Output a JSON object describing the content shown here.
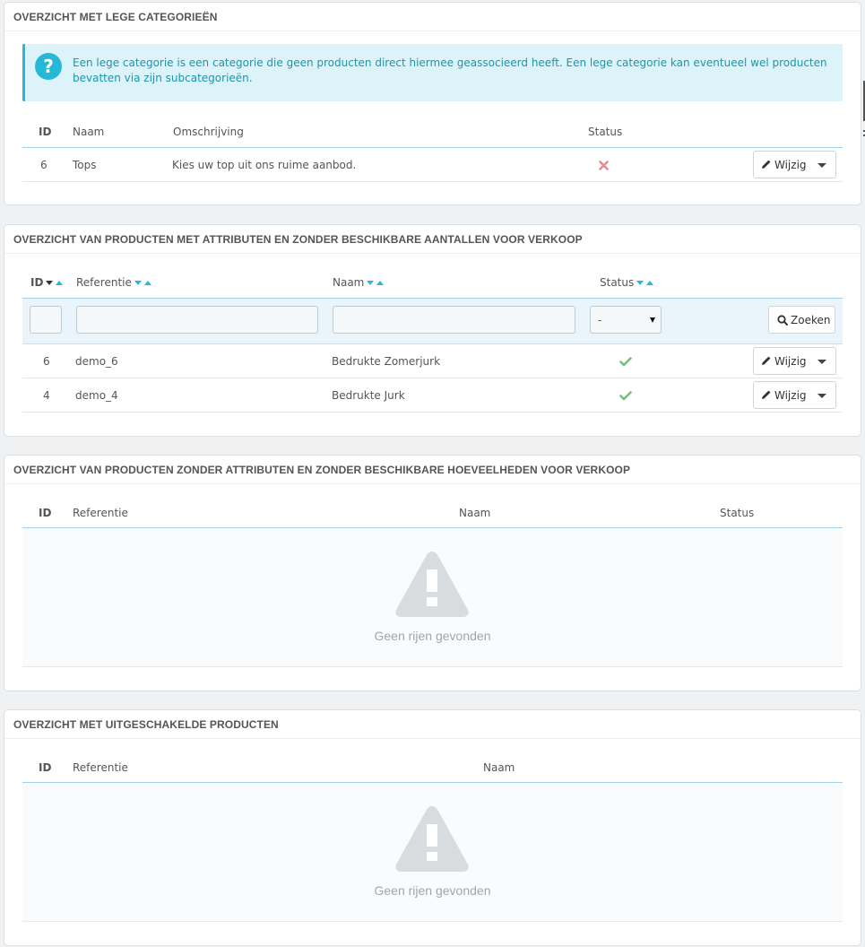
{
  "panel1": {
    "title": "OVERZICHT MET LEGE CATEGORIEËN",
    "alert": "Een lege categorie is een categorie die geen producten direct hiermee geassocieerd heeft. Een lege categorie kan eventueel wel producten bevatten via zijn subcategorieën.",
    "headers": {
      "id": "ID",
      "name": "Naam",
      "description": "Omschrijving",
      "status": "Status"
    },
    "rows": [
      {
        "id": "6",
        "name": "Tops",
        "description": "Kies uw top uit ons ruime aanbod.",
        "status": "disabled",
        "action": "Wijzig"
      }
    ]
  },
  "panel2": {
    "title": "OVERZICHT VAN PRODUCTEN MET ATTRIBUTEN EN ZONDER BESCHIKBARE AANTALLEN VOOR VERKOOP",
    "headers": {
      "id": "ID",
      "reference": "Referentie",
      "name": "Naam",
      "status": "Status"
    },
    "filter": {
      "status_selected": "-",
      "search_label": "Zoeken"
    },
    "rows": [
      {
        "id": "6",
        "reference": "demo_6",
        "name": "Bedrukte Zomerjurk",
        "status": "enabled",
        "action": "Wijzig"
      },
      {
        "id": "4",
        "reference": "demo_4",
        "name": "Bedrukte Jurk",
        "status": "enabled",
        "action": "Wijzig"
      }
    ]
  },
  "panel3": {
    "title": "OVERZICHT VAN PRODUCTEN ZONDER ATTRIBUTEN EN ZONDER BESCHIKBARE HOEVEELHEDEN VOOR VERKOOP",
    "headers": {
      "id": "ID",
      "reference": "Referentie",
      "name": "Naam",
      "status": "Status"
    },
    "empty": "Geen rijen gevonden"
  },
  "panel4": {
    "title": "OVERZICHT MET UITGESCHAKELDE PRODUCTEN",
    "headers": {
      "id": "ID",
      "reference": "Referentie",
      "name": "Naam"
    },
    "empty": "Geen rijen gevonden"
  },
  "colors": {
    "accent": "#25b9d7",
    "success": "#72c279",
    "danger": "#e08f95"
  },
  "icons": [
    "help-icon",
    "pencil-icon",
    "caret-down-icon",
    "search-icon",
    "check-icon",
    "cross-icon",
    "warning-icon"
  ]
}
